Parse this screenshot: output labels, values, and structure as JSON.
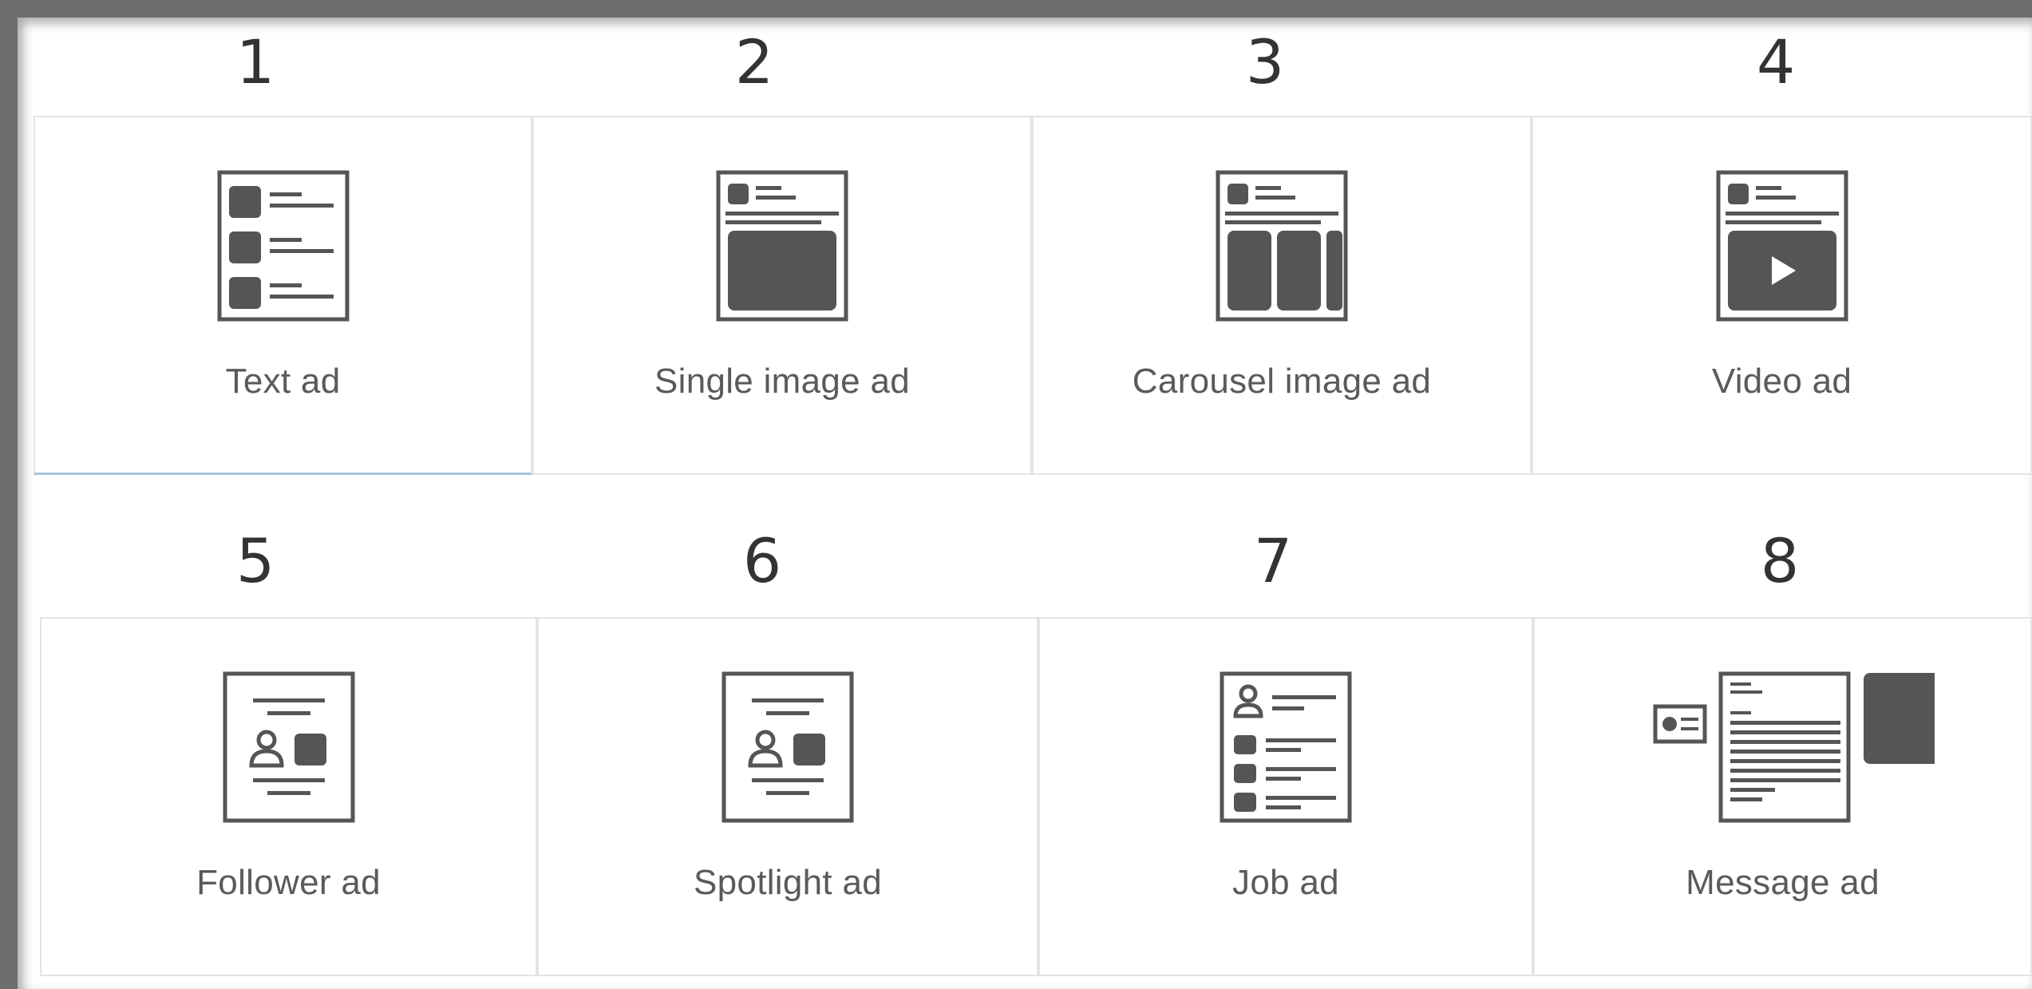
{
  "ad_types": [
    {
      "number": "1",
      "label": "Text ad",
      "icon": "text-ad-icon"
    },
    {
      "number": "2",
      "label": "Single image ad",
      "icon": "single-image-ad-icon"
    },
    {
      "number": "3",
      "label": "Carousel image ad",
      "icon": "carousel-image-ad-icon"
    },
    {
      "number": "4",
      "label": "Video ad",
      "icon": "video-ad-icon"
    },
    {
      "number": "5",
      "label": "Follower ad",
      "icon": "follower-ad-icon"
    },
    {
      "number": "6",
      "label": "Spotlight ad",
      "icon": "spotlight-ad-icon"
    },
    {
      "number": "7",
      "label": "Job ad",
      "icon": "job-ad-icon"
    },
    {
      "number": "8",
      "label": "Message ad",
      "icon": "message-ad-icon"
    }
  ],
  "colors": {
    "icon_fill": "#555555",
    "label_text": "#5a5a5a",
    "number_text": "#333333",
    "tile_border": "#e4e4e4",
    "selected_underline": "#a9c4d6",
    "frame": "#6e6e6e"
  }
}
